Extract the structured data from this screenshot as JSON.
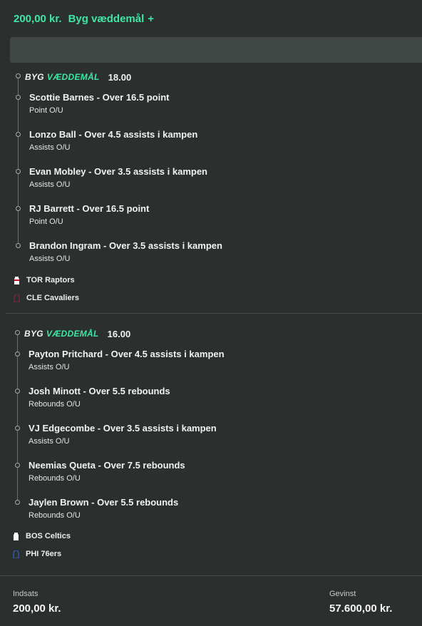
{
  "header": {
    "amount": "200,00 kr.",
    "label": "Byg væddemål",
    "plus": "+"
  },
  "bets": [
    {
      "byg": "BYG",
      "vaeddemaal": "VÆDDEMÅL",
      "odds": "18.00",
      "legs": [
        {
          "title": "Scottie Barnes - Over 16.5 point",
          "sub": "Point O/U"
        },
        {
          "title": "Lonzo Ball - Over 4.5 assists i kampen",
          "sub": "Assists O/U"
        },
        {
          "title": "Evan Mobley - Over 3.5 assists i kampen",
          "sub": "Assists O/U"
        },
        {
          "title": "RJ Barrett - Over 16.5 point",
          "sub": "Point O/U"
        },
        {
          "title": "Brandon Ingram - Over 3.5 assists i kampen",
          "sub": "Assists O/U"
        }
      ],
      "teams": [
        {
          "name": "TOR Raptors",
          "icon": "jersey-icon",
          "color": "#ffffff",
          "accent": "#c8102e"
        },
        {
          "name": "CLE Cavaliers",
          "icon": "jersey-icon",
          "color": "#6f263d",
          "accent": "#6f263d"
        }
      ]
    },
    {
      "byg": "BYG",
      "vaeddemaal": "VÆDDEMÅL",
      "odds": "16.00",
      "legs": [
        {
          "title": "Payton Pritchard - Over 4.5 assists i kampen",
          "sub": "Assists O/U"
        },
        {
          "title": "Josh Minott - Over 5.5 rebounds",
          "sub": "Rebounds O/U"
        },
        {
          "title": "VJ Edgecombe - Over 3.5 assists i kampen",
          "sub": "Assists O/U"
        },
        {
          "title": "Neemias Queta - Over 7.5 rebounds",
          "sub": "Rebounds O/U"
        },
        {
          "title": "Jaylen Brown - Over 5.5 rebounds",
          "sub": "Rebounds O/U"
        }
      ],
      "teams": [
        {
          "name": "BOS Celtics",
          "icon": "jersey-icon",
          "color": "#ffffff",
          "accent": "#ffffff"
        },
        {
          "name": "PHI 76ers",
          "icon": "jersey-icon",
          "color": "#1d428a",
          "accent": "#1d428a"
        }
      ]
    }
  ],
  "footer": {
    "stake_label": "Indsats",
    "stake_value": "200,00 kr.",
    "win_label": "Gevinst",
    "win_value": "57.600,00 kr."
  },
  "colors": {
    "accent": "#3ee6a8",
    "background": "#2b2f2d",
    "bar": "#414744"
  }
}
